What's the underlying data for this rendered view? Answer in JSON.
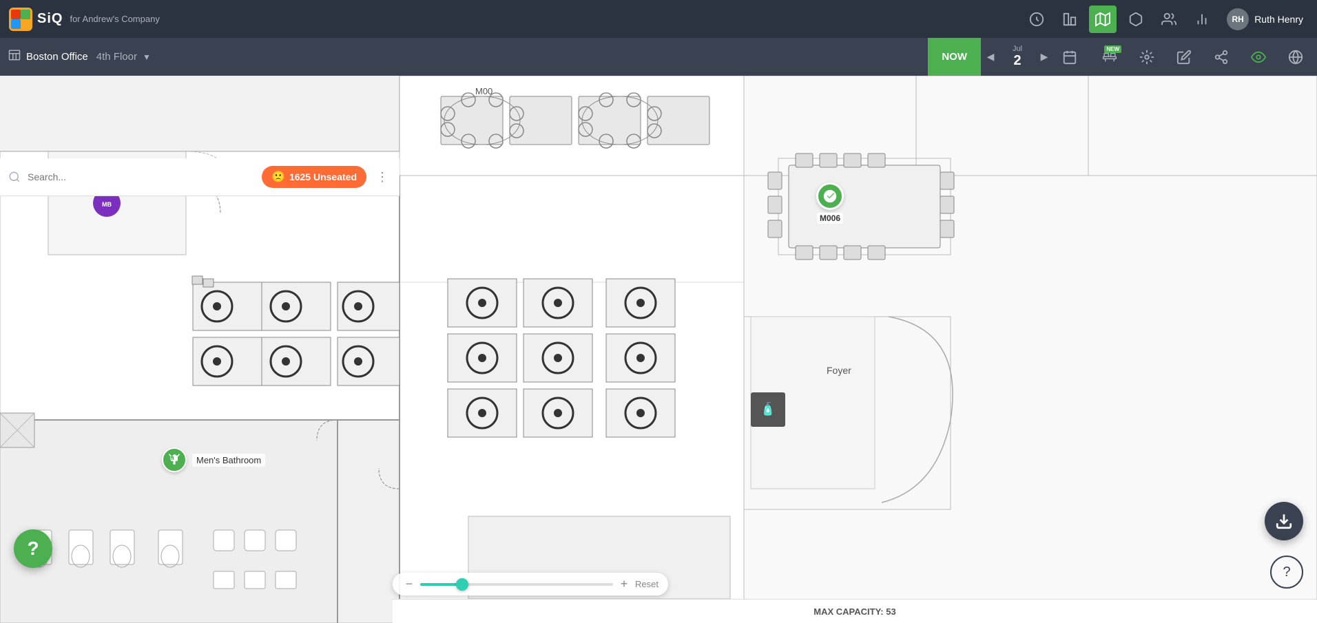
{
  "app": {
    "logo_text": "SiQ",
    "for_text": "for  Andrew's Company"
  },
  "nav_icons": [
    {
      "name": "notifications-icon",
      "symbol": "🔔",
      "active": false
    },
    {
      "name": "buildings-icon",
      "symbol": "⬛",
      "active": false
    },
    {
      "name": "map-icon",
      "symbol": "🗺",
      "active": true
    },
    {
      "name": "box-icon",
      "symbol": "📦",
      "active": false
    },
    {
      "name": "people-icon",
      "symbol": "👤",
      "active": false
    },
    {
      "name": "chart-icon",
      "symbol": "📊",
      "active": false
    }
  ],
  "user": {
    "name": "Ruth Henry",
    "initials": "RH"
  },
  "office": {
    "name": "Boston Office",
    "floor": "4th Floor"
  },
  "date": {
    "now_label": "NOW",
    "month": "Jul",
    "day": "2"
  },
  "toolbar_icons": [
    {
      "name": "desk-booking-icon",
      "symbol": "🪑",
      "has_new": true
    },
    {
      "name": "wayfinding-icon",
      "symbol": "🔄"
    },
    {
      "name": "edit-icon",
      "symbol": "✏️"
    },
    {
      "name": "share-icon",
      "symbol": "↗"
    },
    {
      "name": "eye-icon",
      "symbol": "👁"
    },
    {
      "name": "globe-icon",
      "symbol": "🌐"
    }
  ],
  "search": {
    "placeholder": "Search...",
    "unseated_count": "1625 Unseated"
  },
  "floor_plan": {
    "zoom_label": "Reset",
    "max_capacity": "MAX CAPACITY: 53"
  },
  "markers": {
    "m00_label": "M00",
    "m006_label": "M006",
    "mens_bathroom_label": "Men's Bathroom",
    "foyer_label": "Foyer"
  },
  "fabs": {
    "download_symbol": "⬇",
    "help_symbol": "?",
    "help_br_symbol": "?"
  }
}
